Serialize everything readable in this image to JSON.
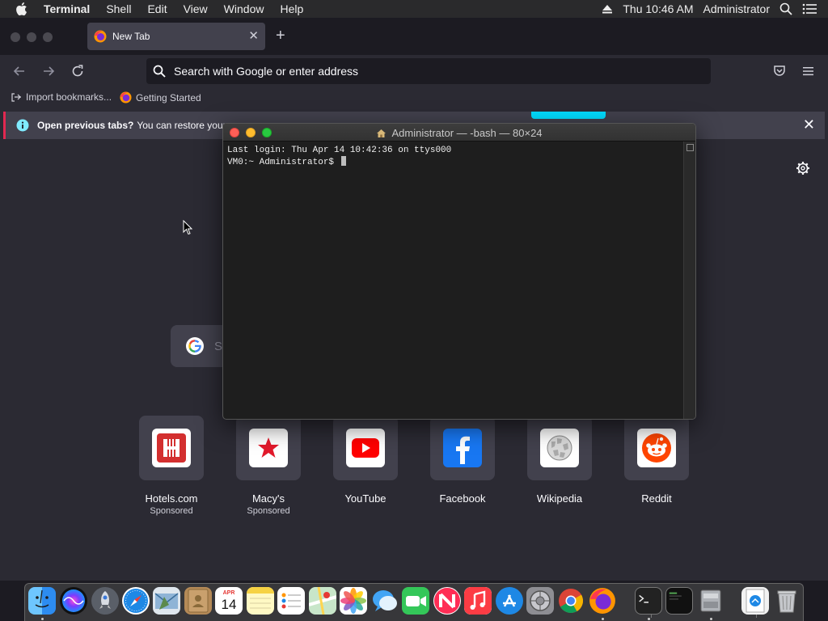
{
  "menubar": {
    "app": "Terminal",
    "items": [
      "Shell",
      "Edit",
      "View",
      "Window",
      "Help"
    ],
    "clock": "Thu 10:46 AM",
    "user": "Administrator"
  },
  "firefox": {
    "tab_title": "New Tab",
    "url_placeholder": "Search with Google or enter address",
    "bookmarks": [
      "Import bookmarks...",
      "Getting Started"
    ],
    "infobar": {
      "title": "Open previous tabs?",
      "text": "You can restore your p"
    },
    "search_placeholder": "S",
    "top_sites": [
      {
        "label": "Hotels.com",
        "sub": "Sponsored",
        "color": "#d32f2f"
      },
      {
        "label": "Macy's",
        "sub": "Sponsored",
        "color": "#ffffff"
      },
      {
        "label": "YouTube",
        "sub": "",
        "color": "#ffffff"
      },
      {
        "label": "Facebook",
        "sub": "",
        "color": "#1877f2"
      },
      {
        "label": "Wikipedia",
        "sub": "",
        "color": "#ffffff"
      },
      {
        "label": "Reddit",
        "sub": "",
        "color": "#ffffff"
      }
    ]
  },
  "terminal": {
    "title": "Administrator — -bash — 80×24",
    "line1": "Last login: Thu Apr 14 10:42:36 on ttys000",
    "prompt": "VM0:~ Administrator$ "
  },
  "dock": {
    "calendar_month": "APR",
    "calendar_day": "14"
  },
  "colors": {
    "accent": "#00ddff",
    "info_border": "#e22850"
  }
}
